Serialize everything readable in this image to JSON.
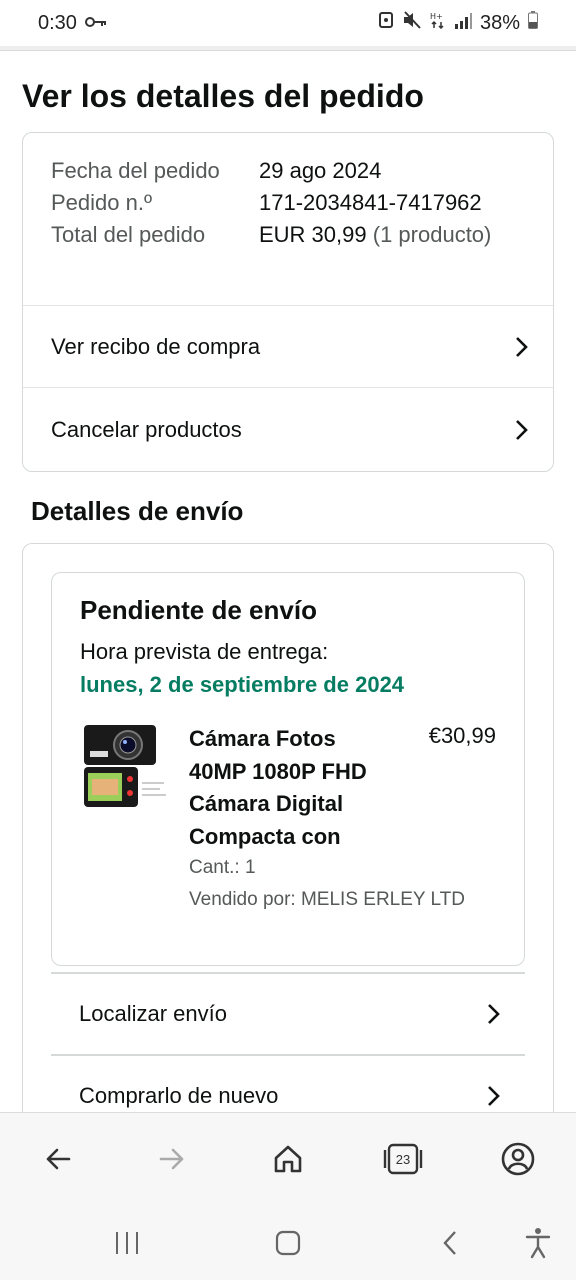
{
  "status_bar": {
    "time": "0:30",
    "battery": "38%"
  },
  "page": {
    "title": "Ver los detalles del pedido"
  },
  "order": {
    "date_label": "Fecha del pedido",
    "date_value": "29 ago 2024",
    "number_label": "Pedido n.º",
    "number_value": "171-2034841-7417962",
    "total_label": "Total del pedido",
    "total_value": "EUR 30,99",
    "total_note": "(1 producto)",
    "links": [
      {
        "label": "Ver recibo de compra"
      },
      {
        "label": "Cancelar productos"
      }
    ]
  },
  "shipping": {
    "section_title": "Detalles de envío",
    "status": "Pendiente de envío",
    "eta_label": "Hora prevista de entrega:",
    "eta_date": "lunes, 2 de septiembre de 2024",
    "product": {
      "title_lines": [
        "Cámara Fotos",
        "40MP 1080P FHD",
        "Cámara Digital",
        "Compacta con"
      ],
      "price": "€30,99",
      "qty": "Cant.: 1",
      "seller": "Vendido por: MELIS ERLEY LTD"
    },
    "links": [
      {
        "label": "Localizar envío"
      },
      {
        "label": "Comprarlo de nuevo"
      }
    ]
  },
  "browser": {
    "tabs_count": "23",
    "icons": [
      "back-icon",
      "forward-icon",
      "home-icon",
      "tabs-icon",
      "account-icon"
    ]
  },
  "system_nav": {
    "icons": [
      "recent-apps-icon",
      "home-icon",
      "back-icon",
      "accessibility-icon"
    ]
  },
  "colors": {
    "eta_green": "#067d62",
    "border": "#d5d9d9",
    "text": "#0f1111",
    "muted": "#565959"
  }
}
